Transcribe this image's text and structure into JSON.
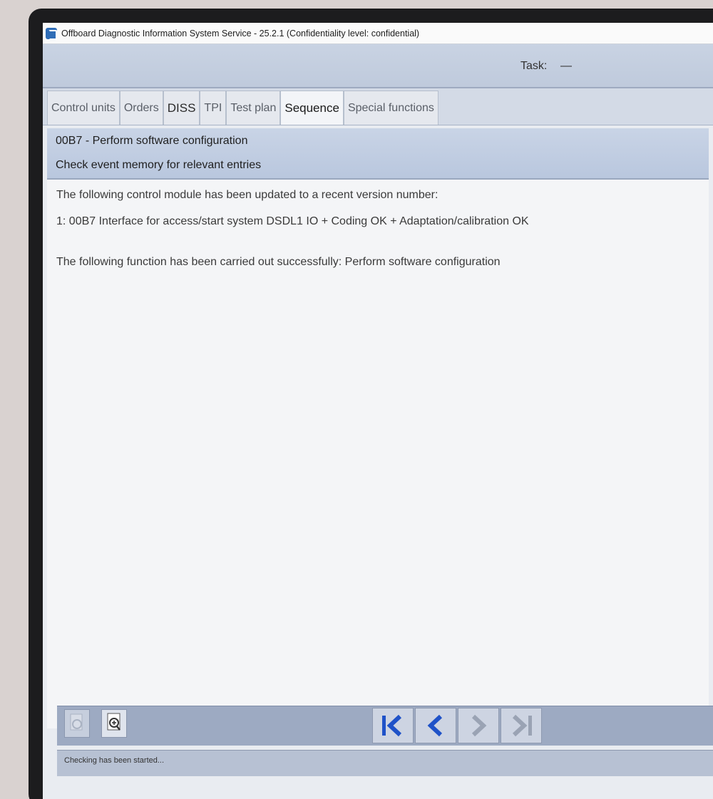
{
  "window": {
    "title": "Offboard Diagnostic Information System Service - 25.2.1 (Confidentiality level: confidential)"
  },
  "task": {
    "label": "Task:",
    "value": "—"
  },
  "tabs": [
    {
      "label": "Control units"
    },
    {
      "label": "Orders"
    },
    {
      "label": "DISS"
    },
    {
      "label": "TPI"
    },
    {
      "label": "Test plan"
    },
    {
      "label": "Sequence"
    },
    {
      "label": "Special functions"
    }
  ],
  "header": {
    "title": "00B7 - Perform software configuration",
    "subtitle": "Check event memory for relevant entries"
  },
  "content": {
    "line1": "The following control module has been updated to a recent version number:",
    "line2": "1: 00B7 Interface for access/start system DSDL1 IO + Coding OK + Adaptation/calibration OK",
    "line3": "The following function has been carried out successfully: Perform software configuration"
  },
  "status": {
    "text": "Checking has been started..."
  },
  "colors": {
    "nav_blue": "#1f52c8",
    "nav_disabled": "#9aa3b4"
  }
}
